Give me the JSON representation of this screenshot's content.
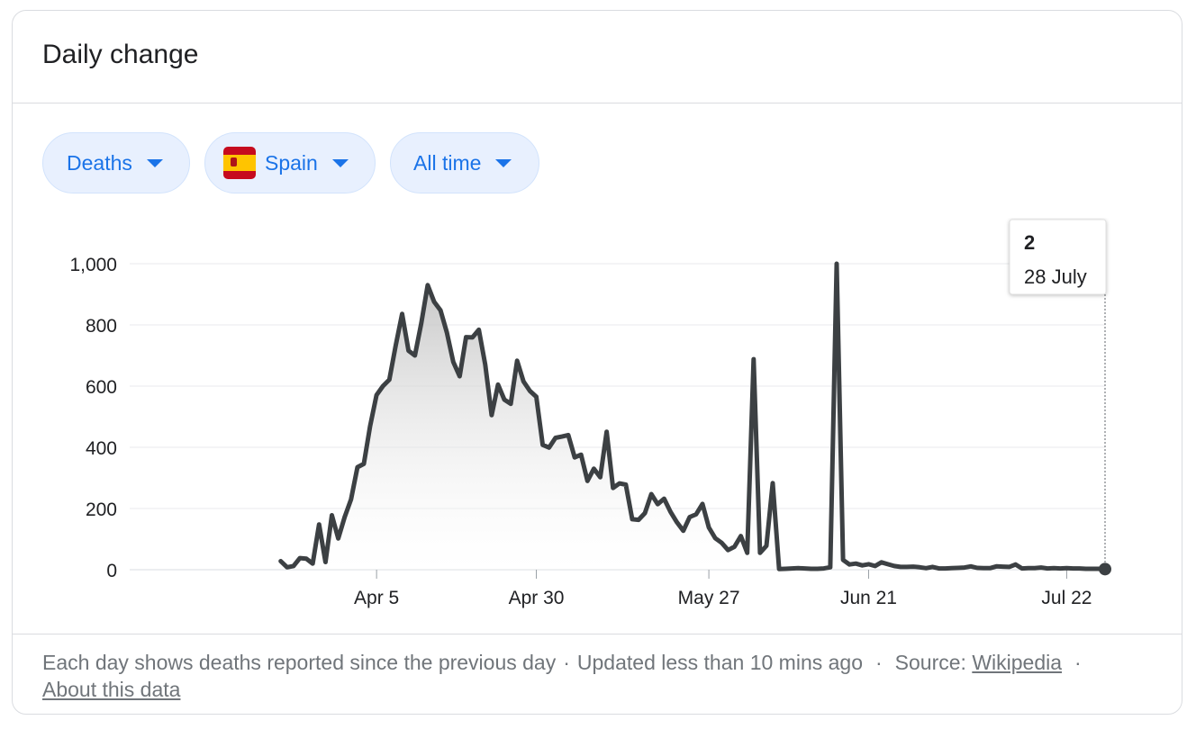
{
  "card": {
    "title": "Daily change"
  },
  "chips": [
    {
      "label": "Deaths",
      "icon": "caret-down-icon"
    },
    {
      "label": "Spain",
      "icon": "caret-down-icon",
      "flag": "spain-flag-icon"
    },
    {
      "label": "All time",
      "icon": "caret-down-icon"
    }
  ],
  "tooltip": {
    "value": "2",
    "date": "28 July"
  },
  "footer": {
    "description": "Each day shows deaths reported since the previous day",
    "updated": "Updated less than 10 mins ago",
    "source_label": "Source:",
    "source_link": "Wikipedia",
    "about_link": "About this data",
    "separator": "·"
  },
  "colors": {
    "line": "#3c4043",
    "fill_top": "#bdbdbd",
    "chip_bg": "#e8f0fe",
    "chip_text": "#1a73e8",
    "grid": "#e8eaed"
  },
  "chart_data": {
    "type": "area",
    "title": "",
    "xlabel": "",
    "ylabel": "",
    "ylim": [
      0,
      1000
    ],
    "yticks": [
      0,
      200,
      400,
      600,
      800,
      1000
    ],
    "ytick_labels": [
      "0",
      "200",
      "400",
      "600",
      "800",
      "1,000"
    ],
    "x_start": "2020-03-03",
    "x_end": "2020-07-28",
    "xticks": [
      "2020-04-05",
      "2020-04-30",
      "2020-05-27",
      "2020-06-21",
      "2020-07-22"
    ],
    "xtick_labels": [
      "Apr 5",
      "Apr 30",
      "May 27",
      "Jun 21",
      "Jul 22"
    ],
    "grid": true,
    "values": [
      28,
      8,
      12,
      38,
      36,
      20,
      148,
      25,
      178,
      102,
      172,
      230,
      335,
      346,
      470,
      571,
      600,
      621,
      733,
      836,
      716,
      700,
      806,
      930,
      876,
      848,
      775,
      679,
      632,
      760,
      759,
      784,
      670,
      505,
      605,
      556,
      542,
      683,
      615,
      584,
      565,
      408,
      399,
      431,
      435,
      440,
      367,
      376,
      290,
      330,
      302,
      451,
      267,
      282,
      278,
      165,
      163,
      185,
      247,
      214,
      232,
      189,
      155,
      127,
      172,
      181,
      215,
      138,
      103,
      88,
      64,
      75,
      110,
      55,
      688,
      55,
      78,
      283,
      2,
      3,
      4,
      5,
      4,
      3,
      3,
      4,
      8,
      1000,
      32,
      17,
      20,
      14,
      18,
      12,
      24,
      18,
      12,
      9,
      9,
      10,
      8,
      5,
      9,
      4,
      4,
      5,
      6,
      7,
      11,
      6,
      5,
      5,
      11,
      10,
      9,
      17,
      4,
      5,
      5,
      7,
      4,
      5,
      4,
      5,
      4,
      4,
      3,
      3,
      3,
      2
    ]
  }
}
